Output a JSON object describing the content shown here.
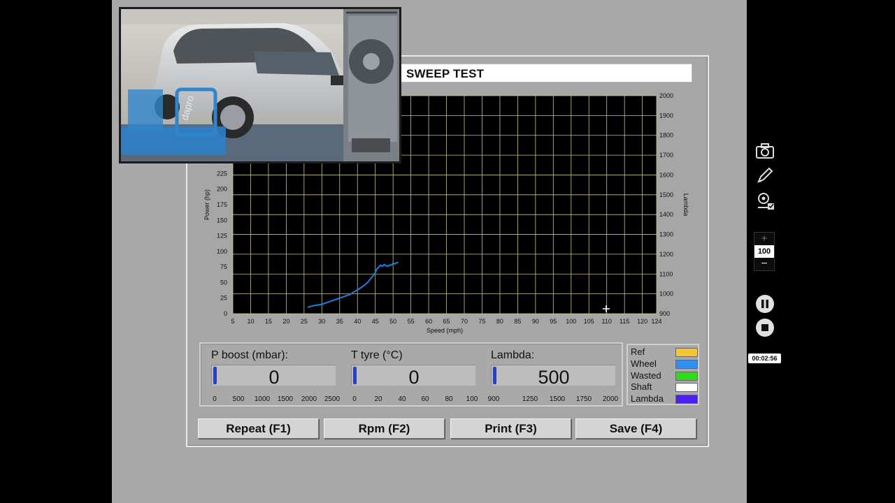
{
  "test_title": "SWEEP TEST",
  "chart_data": {
    "type": "line",
    "xlabel": "Speed (mph)",
    "ylabel_left": "Power (hp)",
    "ylabel_right": "Lambda",
    "x_ticks": [
      "5",
      "10",
      "15",
      "20",
      "25",
      "30",
      "35",
      "40",
      "45",
      "50",
      "55",
      "60",
      "65",
      "70",
      "75",
      "80",
      "85",
      "90",
      "95",
      "100",
      "105",
      "110",
      "115",
      "120",
      "124"
    ],
    "y_left_ticks": [
      "0",
      "25",
      "50",
      "75",
      "100",
      "125",
      "150",
      "175",
      "200",
      "225"
    ],
    "y_right_ticks": [
      "900",
      "1000",
      "1100",
      "1200",
      "1300",
      "1400",
      "1500",
      "1600",
      "1700",
      "1800",
      "1900",
      "2000"
    ],
    "xlim": [
      5,
      124
    ],
    "ylim_left": [
      0,
      350
    ],
    "ylim_right": [
      900,
      2000
    ],
    "grid": true,
    "background": "#000000",
    "grid_color": "#c8c48a",
    "series": [
      {
        "name": "Wheel",
        "color": "#1e7fe0",
        "x": [
          26,
          27,
          28,
          29,
          30,
          31,
          32,
          33,
          34,
          35,
          36,
          37,
          38,
          39,
          40,
          41,
          42,
          43,
          43.5,
          44,
          44.5,
          45,
          45.5,
          46,
          46.5,
          47,
          47.5,
          48,
          48.5,
          49,
          49.5,
          50,
          50.5,
          51,
          51.5
        ],
        "y": [
          10,
          12,
          13,
          14,
          15,
          17,
          19,
          21,
          23,
          25,
          27,
          29,
          31,
          35,
          38,
          42,
          46,
          51,
          55,
          58,
          62,
          66,
          72,
          75,
          78,
          76,
          79,
          77,
          76,
          78,
          78,
          81,
          80,
          82,
          82
        ]
      }
    ]
  },
  "gauges": [
    {
      "label": "P boost (mbar):",
      "value": "0",
      "ticks": [
        "0",
        "500",
        "1000",
        "1500",
        "2000",
        "2500"
      ]
    },
    {
      "label": "T tyre (°C)",
      "value": "0",
      "ticks": [
        "0",
        "20",
        "40",
        "60",
        "80",
        "100"
      ]
    },
    {
      "label": "Lambda:",
      "value": "500",
      "ticks": [
        "900",
        "1250",
        "1500",
        "1750",
        "2000"
      ]
    }
  ],
  "legend": [
    {
      "label": "Ref",
      "color": "#f7c630"
    },
    {
      "label": "Wheel",
      "color": "#2f90f0"
    },
    {
      "label": "Wasted",
      "color": "#2edc1a"
    },
    {
      "label": "Shaft",
      "color": "#ffffff"
    },
    {
      "label": "Lambda",
      "color": "#4b1fee"
    }
  ],
  "buttons": {
    "repeat": "Repeat (F1)",
    "rpm": "Rpm (F2)",
    "print": "Print (F3)",
    "save": "Save (F4)"
  },
  "recorder": {
    "icons": [
      "camera-icon",
      "pen-icon",
      "webcam-icon",
      "pause-icon",
      "stop-icon"
    ],
    "zoom_plus": "+",
    "zoom_value": "100",
    "zoom_minus": "−",
    "timer": "00:02:56"
  }
}
